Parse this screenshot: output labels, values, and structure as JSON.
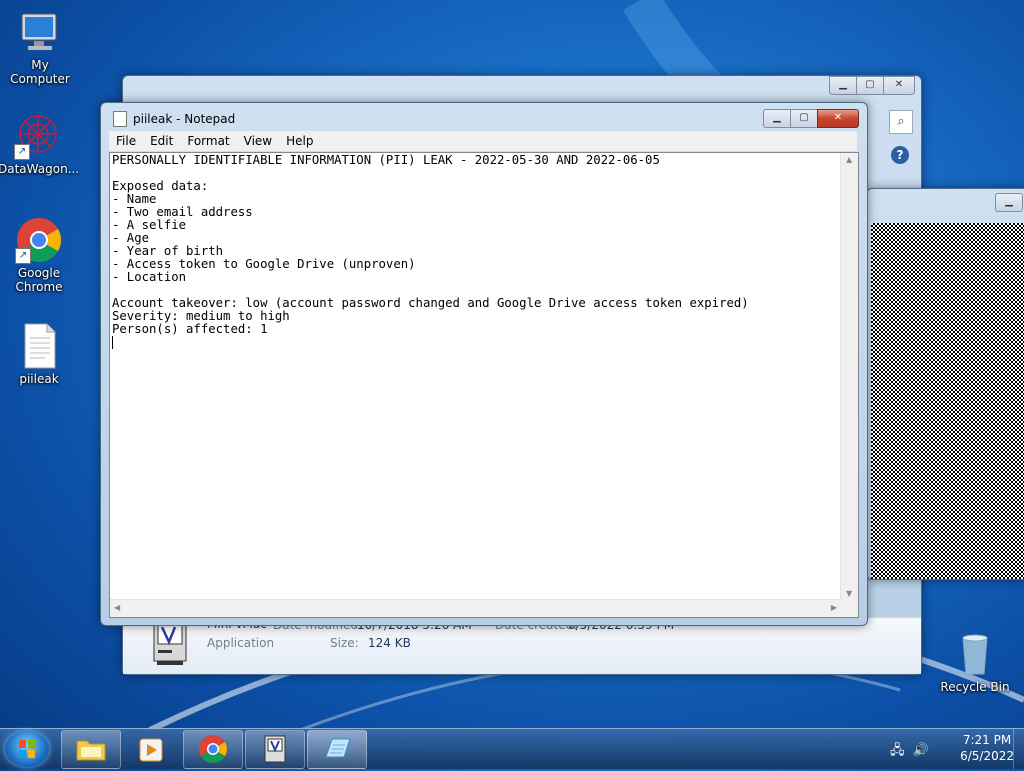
{
  "desktop": {
    "icons": [
      {
        "label": "My Computer",
        "icon": "computer-icon"
      },
      {
        "label": "DataWagon...",
        "icon": "datawagon-icon"
      },
      {
        "label": "Google Chrome",
        "icon": "chrome-icon"
      },
      {
        "label": "piileak",
        "icon": "text-file-icon"
      },
      {
        "label": "Recycle Bin",
        "icon": "recycle-bin-icon"
      }
    ]
  },
  "notepad": {
    "title": "piileak - Notepad",
    "menu": [
      "File",
      "Edit",
      "Format",
      "View",
      "Help"
    ],
    "content": "PERSONALLY IDENTIFIABLE INFORMATION (PII) LEAK - 2022-05-30 AND 2022-06-05\n\nExposed data:\n- Name\n- Two email address\n- A selfie\n- Age\n- Year of birth\n- Access token to Google Drive (unproven)\n- Location\n\nAccount takeover: low (account password changed and Google Drive access token expired)\nSeverity: medium to high\nPerson(s) affected: 1"
  },
  "explorer": {
    "file_name": "Mini vMac",
    "date_modified_label": "Date modified:",
    "date_modified": "10/7/2018 5:26 AM",
    "date_created_label": "Date created:",
    "date_created": "6/5/2022 6:59 PM",
    "type": "Application",
    "size_label": "Size:",
    "size": "124 KB"
  },
  "taskbar": {
    "time": "7:21 PM",
    "date": "6/5/2022"
  },
  "colors": {
    "desktop": "#1a6fc8",
    "close_button": "#c9452f"
  }
}
